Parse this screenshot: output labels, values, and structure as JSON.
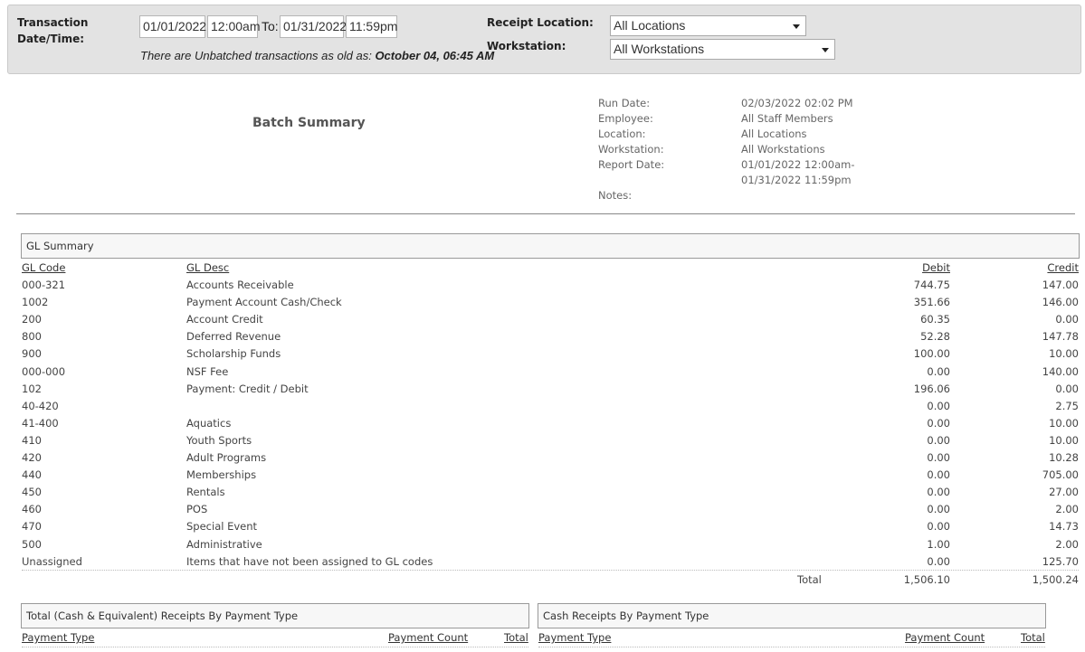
{
  "filters": {
    "date_label_line1": "Transaction",
    "date_label_line2": "Date/Time:",
    "start_date": "01/01/2022",
    "start_time": "12:00am",
    "to_label": "To:",
    "end_date": "01/31/2022",
    "end_time": "11:59pm",
    "unbatched_prefix": "There are Unbatched transactions as old as: ",
    "unbatched_date": "October 04, 06:45 AM",
    "receipt_location_label": "Receipt Location:",
    "receipt_location_value": "All Locations",
    "workstation_label": "Workstation:",
    "workstation_value": "All Workstations"
  },
  "report": {
    "title": "Batch Summary",
    "meta": {
      "run_date_label": "Run Date:",
      "run_date": "02/03/2022 02:02 PM",
      "employee_label": "Employee:",
      "employee": "All Staff Members",
      "location_label": "Location:",
      "location": "All Locations",
      "workstation_label": "Workstation:",
      "workstation": "All Workstations",
      "report_date_label": "Report Date:",
      "report_date_line1": "01/01/2022 12:00am-",
      "report_date_line2": "01/31/2022 11:59pm",
      "notes_label": "Notes:"
    }
  },
  "gl_summary": {
    "heading": "GL Summary",
    "columns": {
      "code": "GL Code",
      "desc": "GL Desc",
      "debit": "Debit",
      "credit": "Credit"
    },
    "rows": [
      {
        "code": "000-321",
        "desc": "Accounts Receivable",
        "debit": "744.75",
        "credit": "147.00"
      },
      {
        "code": "1002",
        "desc": "Payment Account Cash/Check",
        "debit": "351.66",
        "credit": "146.00"
      },
      {
        "code": "200",
        "desc": "Account Credit",
        "debit": "60.35",
        "credit": "0.00"
      },
      {
        "code": "800",
        "desc": "Deferred Revenue",
        "debit": "52.28",
        "credit": "147.78"
      },
      {
        "code": "900",
        "desc": "Scholarship Funds",
        "debit": "100.00",
        "credit": "10.00"
      },
      {
        "code": "000-000",
        "desc": "NSF Fee",
        "debit": "0.00",
        "credit": "140.00"
      },
      {
        "code": "102",
        "desc": "Payment: Credit / Debit",
        "debit": "196.06",
        "credit": "0.00"
      },
      {
        "code": "40-420",
        "desc": "",
        "debit": "0.00",
        "credit": "2.75"
      },
      {
        "code": "41-400",
        "desc": "Aquatics",
        "debit": "0.00",
        "credit": "10.00"
      },
      {
        "code": "410",
        "desc": "Youth Sports",
        "debit": "0.00",
        "credit": "10.00"
      },
      {
        "code": "420",
        "desc": "Adult Programs",
        "debit": "0.00",
        "credit": "10.28"
      },
      {
        "code": "440",
        "desc": "Memberships",
        "debit": "0.00",
        "credit": "705.00"
      },
      {
        "code": "450",
        "desc": "Rentals",
        "debit": "0.00",
        "credit": "27.00"
      },
      {
        "code": "460",
        "desc": "POS",
        "debit": "0.00",
        "credit": "2.00"
      },
      {
        "code": "470",
        "desc": "Special Event",
        "debit": "0.00",
        "credit": "14.73"
      },
      {
        "code": "500",
        "desc": "Administrative",
        "debit": "1.00",
        "credit": "2.00"
      },
      {
        "code": "Unassigned",
        "desc": "Items that have not been assigned to GL codes",
        "debit": "0.00",
        "credit": "125.70"
      }
    ],
    "total_label": "Total",
    "total_debit": "1,506.10",
    "total_credit": "1,500.24"
  },
  "receipts_total": {
    "heading": "Total (Cash & Equivalent) Receipts By Payment Type",
    "columns": {
      "type": "Payment Type",
      "count": "Payment Count",
      "total": "Total"
    }
  },
  "receipts_cash": {
    "heading": "Cash Receipts By Payment Type",
    "columns": {
      "type": "Payment Type",
      "count": "Payment Count",
      "total": "Total"
    }
  }
}
